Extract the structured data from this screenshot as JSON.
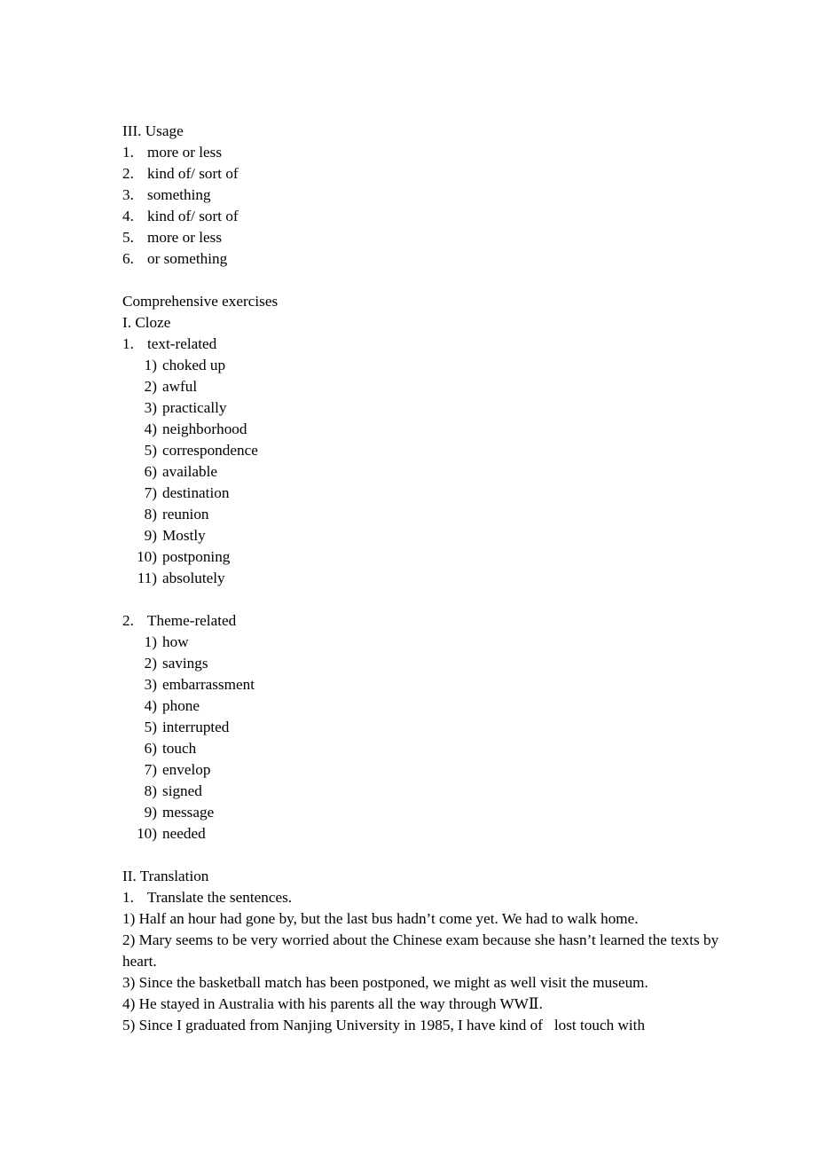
{
  "document": {
    "background_color": "#ffffff",
    "text_color": "#000000"
  },
  "sections": {
    "usage": {
      "heading": "III. Usage",
      "items": [
        {
          "marker": "1.",
          "text": "more or less"
        },
        {
          "marker": "2.",
          "text": "kind of/ sort of"
        },
        {
          "marker": "3.",
          "text": "something"
        },
        {
          "marker": "4.",
          "text": "kind of/ sort of"
        },
        {
          "marker": "5.",
          "text": "more or less"
        },
        {
          "marker": "6.",
          "text": "or something"
        }
      ]
    },
    "comprehensive": {
      "heading": "Comprehensive exercises"
    },
    "cloze": {
      "heading": "I. Cloze",
      "group1": {
        "marker": "1.",
        "title": "text-related",
        "items": [
          {
            "marker": "1)",
            "text": "choked up"
          },
          {
            "marker": "2)",
            "text": "awful"
          },
          {
            "marker": "3)",
            "text": "practically"
          },
          {
            "marker": "4)",
            "text": "neighborhood"
          },
          {
            "marker": "5)",
            "text": "correspondence"
          },
          {
            "marker": "6)",
            "text": "available"
          },
          {
            "marker": "7)",
            "text": "destination"
          },
          {
            "marker": "8)",
            "text": "reunion"
          },
          {
            "marker": "9)",
            "text": "Mostly"
          },
          {
            "marker": "10)",
            "text": "postponing"
          },
          {
            "marker": "11)",
            "text": "absolutely"
          }
        ]
      },
      "group2": {
        "marker": "2.",
        "title": "Theme-related",
        "items": [
          {
            "marker": "1)",
            "text": "how"
          },
          {
            "marker": "2)",
            "text": "savings"
          },
          {
            "marker": "3)",
            "text": "embarrassment"
          },
          {
            "marker": "4)",
            "text": "phone"
          },
          {
            "marker": "5)",
            "text": "interrupted"
          },
          {
            "marker": "6)",
            "text": "touch"
          },
          {
            "marker": "7)",
            "text": "envelop"
          },
          {
            "marker": "8)",
            "text": "signed"
          },
          {
            "marker": "9)",
            "text": "message"
          },
          {
            "marker": "10)",
            "text": "needed"
          }
        ]
      }
    },
    "translation": {
      "heading": "II. Translation",
      "task": {
        "marker": "1.",
        "text": "Translate the sentences."
      },
      "sentences": [
        "1) Half an hour had gone by, but the last bus hadn’t come yet. We had to walk home.",
        "2) Mary seems to be very worried about the Chinese exam because she hasn’t learned the texts by heart.",
        "3) Since the basketball match has been postponed, we might as well visit the museum.",
        "4) He stayed in Australia with his parents all the way through WWⅡ.",
        "5) Since I graduated from Nanjing University in 1985, I have kind of   lost touch with"
      ]
    }
  }
}
